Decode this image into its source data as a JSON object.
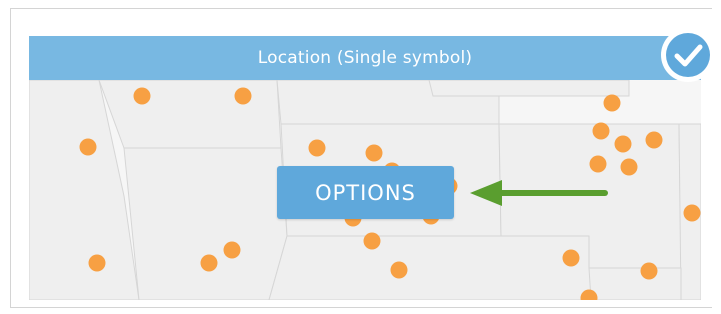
{
  "widget": {
    "title": "Location (Single symbol)",
    "options_label": "OPTIONS"
  },
  "icons": {
    "check": "check-circle-icon",
    "arrow": "arrow-left-icon",
    "point": "map-point-marker"
  },
  "colors": {
    "title_bar": "#78b8e2",
    "options_button": "#5fa8db",
    "point": "#f7a043",
    "arrow": "#5a9e2f",
    "check_badge": "#5fa8db",
    "map_land": "#f1f1f1",
    "map_border": "#d6d6d6"
  }
}
